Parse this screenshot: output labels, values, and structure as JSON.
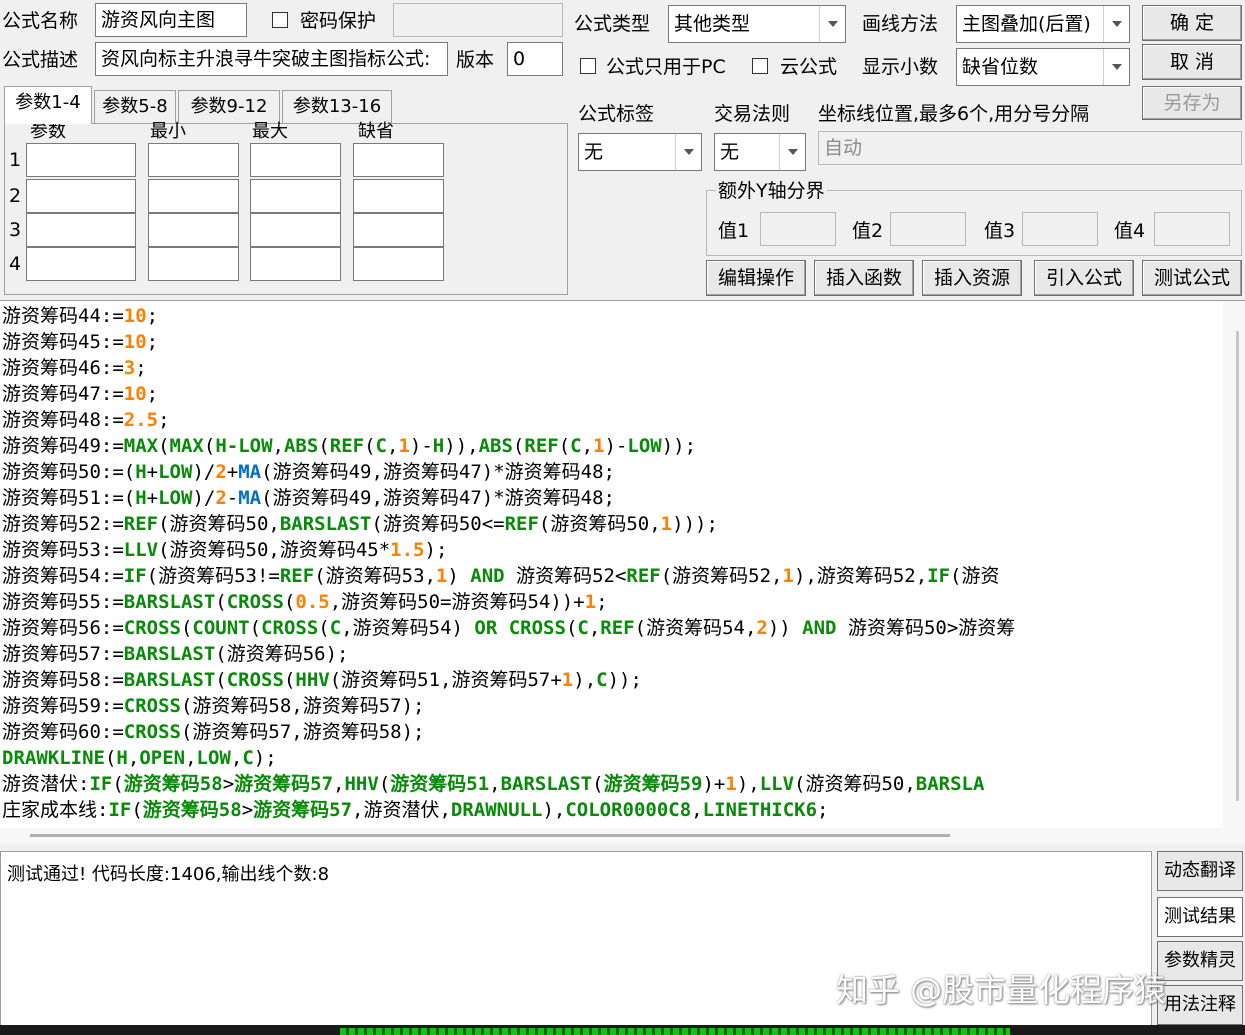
{
  "header": {
    "name_label": "公式名称",
    "name_value": "游资风向主图",
    "password_label": "密码保护",
    "desc_label": "公式描述",
    "desc_value": "资风向标主升浪寻牛突破主图指标公式:",
    "version_label": "版本",
    "version_value": "0",
    "type_label": "公式类型",
    "type_value": "其他类型",
    "draw_label": "画线方法",
    "draw_value": "主图叠加(后置)",
    "pc_only_label": "公式只用于PC",
    "cloud_label": "云公式",
    "decimals_label": "显示小数",
    "decimals_value": "缺省位数"
  },
  "buttons": {
    "ok": "确 定",
    "cancel": "取 消",
    "save_as": "另存为",
    "edit_ops": "编辑操作",
    "insert_func": "插入函数",
    "insert_res": "插入资源",
    "import_formula": "引入公式",
    "test_formula": "测试公式"
  },
  "tabs": [
    "参数1-4",
    "参数5-8",
    "参数9-12",
    "参数13-16"
  ],
  "params": {
    "headers": [
      "参数",
      "最小",
      "最大",
      "缺省"
    ],
    "rows": [
      "1",
      "2",
      "3",
      "4"
    ]
  },
  "tag": {
    "tag_label": "公式标签",
    "tag_value": "无",
    "trade_label": "交易法则",
    "trade_value": "无",
    "axis_label": "坐标线位置,最多6个,用分号分隔",
    "axis_value": "自动",
    "y_group_label": "额外Y轴分界",
    "v1": "值1",
    "v2": "值2",
    "v3": "值3",
    "v4": "值4"
  },
  "code_lines": [
    [
      [
        "t",
        "游资筹码44:="
      ],
      [
        "n",
        "10"
      ],
      [
        "t",
        ";"
      ]
    ],
    [
      [
        "t",
        "游资筹码45:="
      ],
      [
        "n",
        "10"
      ],
      [
        "t",
        ";"
      ]
    ],
    [
      [
        "t",
        "游资筹码46:="
      ],
      [
        "n",
        "3"
      ],
      [
        "t",
        ";"
      ]
    ],
    [
      [
        "t",
        "游资筹码47:="
      ],
      [
        "n",
        "10"
      ],
      [
        "t",
        ";"
      ]
    ],
    [
      [
        "t",
        "游资筹码48:="
      ],
      [
        "n",
        "2.5"
      ],
      [
        "t",
        ";"
      ]
    ],
    [
      [
        "t",
        "游资筹码49:="
      ],
      [
        "k",
        "MAX"
      ],
      [
        "t",
        "("
      ],
      [
        "k",
        "MAX"
      ],
      [
        "t",
        "("
      ],
      [
        "k",
        "H-LOW"
      ],
      [
        "t",
        ","
      ],
      [
        "k",
        "ABS"
      ],
      [
        "t",
        "("
      ],
      [
        "k",
        "REF"
      ],
      [
        "t",
        "("
      ],
      [
        "k",
        "C"
      ],
      [
        "t",
        ","
      ],
      [
        "n",
        "1"
      ],
      [
        "t",
        ")-"
      ],
      [
        "k",
        "H"
      ],
      [
        "t",
        "))"
      ],
      [
        "t",
        ","
      ],
      [
        "k",
        "ABS"
      ],
      [
        "t",
        "("
      ],
      [
        "k",
        "REF"
      ],
      [
        "t",
        "("
      ],
      [
        "k",
        "C"
      ],
      [
        "t",
        ","
      ],
      [
        "n",
        "1"
      ],
      [
        "t",
        ")-"
      ],
      [
        "k",
        "LOW"
      ],
      [
        "t",
        "));"
      ]
    ],
    [
      [
        "t",
        "游资筹码50:=("
      ],
      [
        "k",
        "H"
      ],
      [
        "t",
        "+"
      ],
      [
        "k",
        "LOW"
      ],
      [
        "t",
        ")/"
      ],
      [
        "n",
        "2"
      ],
      [
        "t",
        "+"
      ],
      [
        "f",
        "MA"
      ],
      [
        "t",
        "(游资筹码49,游资筹码47)*游资筹码48;"
      ]
    ],
    [
      [
        "t",
        "游资筹码51:=("
      ],
      [
        "k",
        "H"
      ],
      [
        "t",
        "+"
      ],
      [
        "k",
        "LOW"
      ],
      [
        "t",
        ")/"
      ],
      [
        "n",
        "2"
      ],
      [
        "t",
        "-"
      ],
      [
        "f",
        "MA"
      ],
      [
        "t",
        "(游资筹码49,游资筹码47)*游资筹码48;"
      ]
    ],
    [
      [
        "t",
        "游资筹码52:="
      ],
      [
        "k",
        "REF"
      ],
      [
        "t",
        "(游资筹码50,"
      ],
      [
        "k",
        "BARSLAST"
      ],
      [
        "t",
        "(游资筹码50<="
      ],
      [
        "k",
        "REF"
      ],
      [
        "t",
        "(游资筹码50,"
      ],
      [
        "n",
        "1"
      ],
      [
        "t",
        ")));"
      ]
    ],
    [
      [
        "t",
        "游资筹码53:="
      ],
      [
        "k",
        "LLV"
      ],
      [
        "t",
        "(游资筹码50,游资筹码45*"
      ],
      [
        "n",
        "1.5"
      ],
      [
        "t",
        ");"
      ]
    ],
    [
      [
        "t",
        "游资筹码54:="
      ],
      [
        "k",
        "IF"
      ],
      [
        "t",
        "(游资筹码53!="
      ],
      [
        "k",
        "REF"
      ],
      [
        "t",
        "(游资筹码53,"
      ],
      [
        "n",
        "1"
      ],
      [
        "t",
        ") "
      ],
      [
        "k",
        "AND"
      ],
      [
        "t",
        " 游资筹码52<"
      ],
      [
        "k",
        "REF"
      ],
      [
        "t",
        "(游资筹码52,"
      ],
      [
        "n",
        "1"
      ],
      [
        "t",
        "),游资筹码52,"
      ],
      [
        "k",
        "IF"
      ],
      [
        "t",
        "(游资"
      ]
    ],
    [
      [
        "t",
        "游资筹码55:="
      ],
      [
        "k",
        "BARSLAST"
      ],
      [
        "t",
        "("
      ],
      [
        "k",
        "CROSS"
      ],
      [
        "t",
        "("
      ],
      [
        "n",
        "0.5"
      ],
      [
        "t",
        ",游资筹码50=游资筹码54))+"
      ],
      [
        "n",
        "1"
      ],
      [
        "t",
        ";"
      ]
    ],
    [
      [
        "t",
        "游资筹码56:="
      ],
      [
        "k",
        "CROSS"
      ],
      [
        "t",
        "("
      ],
      [
        "k",
        "COUNT"
      ],
      [
        "t",
        "("
      ],
      [
        "k",
        "CROSS"
      ],
      [
        "t",
        "("
      ],
      [
        "k",
        "C"
      ],
      [
        "t",
        ",游资筹码54) "
      ],
      [
        "k",
        "OR"
      ],
      [
        "t",
        " "
      ],
      [
        "k",
        "CROSS"
      ],
      [
        "t",
        "("
      ],
      [
        "k",
        "C"
      ],
      [
        "t",
        ","
      ],
      [
        "k",
        "REF"
      ],
      [
        "t",
        "(游资筹码54,"
      ],
      [
        "n",
        "2"
      ],
      [
        "t",
        ")) "
      ],
      [
        "k",
        "AND"
      ],
      [
        "t",
        " 游资筹码50>游资筹"
      ]
    ],
    [
      [
        "t",
        "游资筹码57:="
      ],
      [
        "k",
        "BARSLAST"
      ],
      [
        "t",
        "(游资筹码56);"
      ]
    ],
    [
      [
        "t",
        "游资筹码58:="
      ],
      [
        "k",
        "BARSLAST"
      ],
      [
        "t",
        "("
      ],
      [
        "k",
        "CROSS"
      ],
      [
        "t",
        "("
      ],
      [
        "k",
        "HHV"
      ],
      [
        "t",
        "(游资筹码51,游资筹码57+"
      ],
      [
        "n",
        "1"
      ],
      [
        "t",
        "),"
      ],
      [
        "k",
        "C"
      ],
      [
        "t",
        "));"
      ]
    ],
    [
      [
        "t",
        "游资筹码59:="
      ],
      [
        "k",
        "CROSS"
      ],
      [
        "t",
        "(游资筹码58,游资筹码57);"
      ]
    ],
    [
      [
        "t",
        "游资筹码60:="
      ],
      [
        "k",
        "CROSS"
      ],
      [
        "t",
        "(游资筹码57,游资筹码58);"
      ]
    ],
    [
      [
        "k",
        "DRAWKLINE"
      ],
      [
        "t",
        "("
      ],
      [
        "k",
        "H"
      ],
      [
        "t",
        ","
      ],
      [
        "k",
        "OPEN"
      ],
      [
        "t",
        ","
      ],
      [
        "k",
        "LOW"
      ],
      [
        "t",
        ","
      ],
      [
        "k",
        "C"
      ],
      [
        "t",
        ");"
      ]
    ],
    [
      [
        "t",
        "游资潜伏:"
      ],
      [
        "k",
        "IF"
      ],
      [
        "t",
        "("
      ],
      [
        "k",
        "游资筹码58"
      ],
      [
        "t",
        ">"
      ],
      [
        "k",
        "游资筹码57"
      ],
      [
        "t",
        ","
      ],
      [
        "k",
        "HHV"
      ],
      [
        "t",
        "("
      ],
      [
        "k",
        "游资筹码51"
      ],
      [
        "t",
        ","
      ],
      [
        "k",
        "BARSLAST"
      ],
      [
        "t",
        "("
      ],
      [
        "k",
        "游资筹码59"
      ],
      [
        "t",
        ")+"
      ],
      [
        "n",
        "1"
      ],
      [
        "t",
        "),"
      ],
      [
        "k",
        "LLV"
      ],
      [
        "t",
        "(游资筹码50,"
      ],
      [
        "k",
        "BARSLA"
      ]
    ],
    [
      [
        "t",
        "庄家成本线:"
      ],
      [
        "k",
        "IF"
      ],
      [
        "t",
        "("
      ],
      [
        "k",
        "游资筹码58"
      ],
      [
        "t",
        ">"
      ],
      [
        "k",
        "游资筹码57"
      ],
      [
        "t",
        ",游资潜伏,"
      ],
      [
        "k",
        "DRAWNULL"
      ],
      [
        "t",
        "),"
      ],
      [
        "k",
        "COLOR0000C8"
      ],
      [
        "t",
        ","
      ],
      [
        "k",
        "LINETHICK6"
      ],
      [
        "t",
        ";"
      ]
    ]
  ],
  "output": {
    "message": "测试通过! 代码长度:1406,输出线个数:8"
  },
  "side_buttons": [
    "动态翻译",
    "测试结果",
    "参数精灵",
    "用法注释"
  ],
  "watermark": "知乎 @股市量化程序猿"
}
